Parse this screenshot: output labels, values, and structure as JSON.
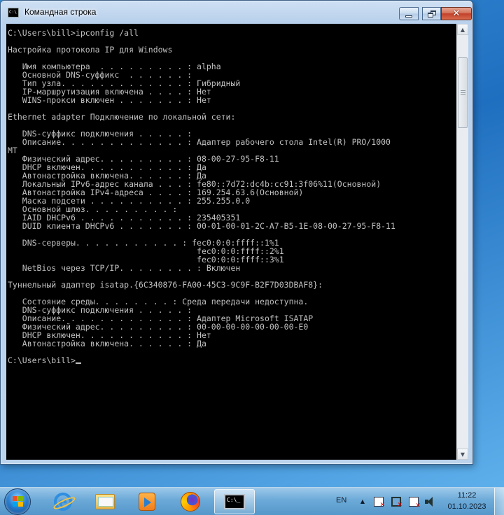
{
  "window": {
    "title": "Командная строка",
    "controls": {
      "minimize": "minimize",
      "maximize": "restore",
      "close": "close"
    }
  },
  "console": {
    "lines": [
      "C:\\Users\\bill>ipconfig /all",
      "",
      "Настройка протокола IP для Windows",
      "",
      "   Имя компьютера  . . . . . . . . . : alpha",
      "   Основной DNS-суффикс  . . . . . . :",
      "   Тип узла. . . . . . . . . . . . . : Гибридный",
      "   IP-маршрутизация включена . . . . : Нет",
      "   WINS-прокси включен . . . . . . . : Нет",
      "",
      "Ethernet adapter Подключение по локальной сети:",
      "",
      "   DNS-суффикс подключения . . . . . :",
      "   Описание. . . . . . . . . . . . . : Адаптер рабочего стола Intel(R) PRO/1000",
      "MT",
      "   Физический адрес. . . . . . . . . : 08-00-27-95-F8-11",
      "   DHCP включен. . . . . . . . . . . : Да",
      "   Автонастройка включена. . . . . . : Да",
      "   Локальный IPv6-адрес канала . . . : fe80::7d72:dc4b:cc91:3f06%11(Основной)",
      "   Автонастройка IPv4-адреса . . . . : 169.254.63.6(Основной)",
      "   Маска подсети . . . . . . . . . . : 255.255.0.0",
      "   Основной шлюз. . . . . . . . . :",
      "   IAID DHCPv6 . . . . . . . . . . . : 235405351",
      "   DUID клиента DHCPv6 . . . . . . . : 00-01-00-01-2C-A7-B5-1E-08-00-27-95-F8-11",
      "",
      "   DNS-серверы. . . . . . . . . . . : fec0:0:0:ffff::1%1",
      "                                       fec0:0:0:ffff::2%1",
      "                                       fec0:0:0:ffff::3%1",
      "   NetBios через TCP/IP. . . . . . . . : Включен",
      "",
      "Туннельный адаптер isatap.{6C340876-FA00-45C3-9C9F-B2F7D03DBAF8}:",
      "",
      "   Состояние среды. . . . . . . . : Среда передачи недоступна.",
      "   DNS-суффикс подключения . . . . . :",
      "   Описание. . . . . . . . . . . . . : Адаптер Microsoft ISATAP",
      "   Физический адрес. . . . . . . . . : 00-00-00-00-00-00-00-E0",
      "   DHCP включен. . . . . . . . . . . : Нет",
      "   Автонастройка включена. . . . . . : Да",
      "",
      "C:\\Users\\bill>"
    ]
  },
  "taskbar": {
    "apps": [
      {
        "name": "start",
        "icon": "windows-flag-icon"
      },
      {
        "name": "internet-explorer",
        "icon": "internet-explorer-icon"
      },
      {
        "name": "explorer",
        "icon": "folder-icon"
      },
      {
        "name": "media-player",
        "icon": "media-player-icon"
      },
      {
        "name": "firefox",
        "icon": "firefox-icon"
      },
      {
        "name": "command-prompt",
        "icon": "cmd-icon",
        "active": true
      }
    ],
    "tray": {
      "language": "EN",
      "time": "11:22",
      "date": "01.10.2023"
    }
  },
  "colors": {
    "console_bg": "#000000",
    "console_fg": "#c0c0c0",
    "close_button": "#c2402a",
    "taskbar": "#6eaad7"
  }
}
